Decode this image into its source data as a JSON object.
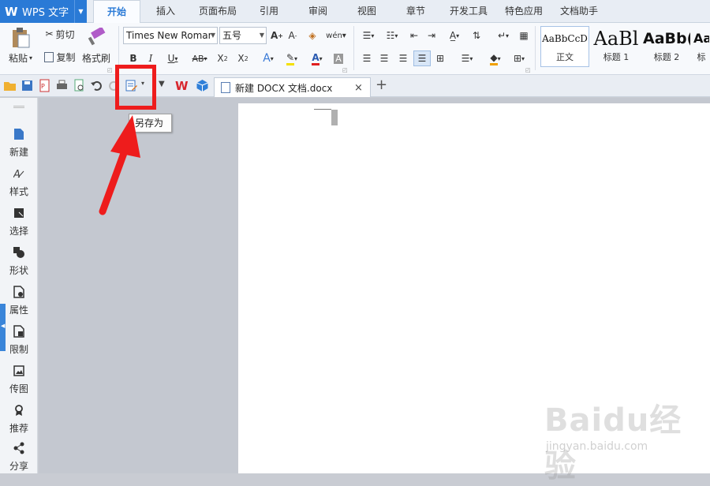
{
  "app": {
    "name": "WPS 文字",
    "brand_color": "#2a7ad6"
  },
  "menu": {
    "tabs": [
      "开始",
      "插入",
      "页面布局",
      "引用",
      "审阅",
      "视图",
      "章节",
      "开发工具",
      "特色应用",
      "文档助手"
    ],
    "active": "开始"
  },
  "ribbon": {
    "paste_label": "粘贴",
    "cut_label": "剪切",
    "copy_label": "复制",
    "format_painter_label": "格式刷",
    "font_name": "Times New Romar",
    "font_size": "五号",
    "styles": [
      {
        "sample": "AaBbCcD",
        "label": "正文"
      },
      {
        "sample": "AaBl",
        "label": "标题 1"
      },
      {
        "sample": "AaBb(",
        "label": "标题 2"
      },
      {
        "sample": "Aa",
        "label": "标"
      }
    ]
  },
  "quick_access": {
    "icons": [
      "open-folder-icon",
      "save-icon",
      "export-pdf-icon",
      "print-icon",
      "print-preview-icon",
      "undo-icon",
      "redo-icon",
      "save-as-icon",
      "dropdown-icon",
      "wps-logo-icon",
      "cube-icon"
    ]
  },
  "document_tab": {
    "title": "新建 DOCX 文档.docx",
    "close": "×",
    "new_tab": "+"
  },
  "sidebar": {
    "items": [
      {
        "label": "新建",
        "icon": "new-doc-icon"
      },
      {
        "label": "样式",
        "icon": "style-icon"
      },
      {
        "label": "选择",
        "icon": "select-icon"
      },
      {
        "label": "形状",
        "icon": "shape-icon"
      },
      {
        "label": "属性",
        "icon": "properties-icon"
      },
      {
        "label": "限制",
        "icon": "restrict-icon"
      },
      {
        "label": "传图",
        "icon": "upload-image-icon"
      },
      {
        "label": "推荐",
        "icon": "recommend-icon"
      },
      {
        "label": "分享",
        "icon": "share-icon"
      }
    ]
  },
  "tooltip": {
    "text": "另存为"
  },
  "annotation": {
    "color": "#ee1c1c"
  },
  "watermark": {
    "main": "Baidu经验",
    "sub": "jingyan.baidu.com"
  }
}
